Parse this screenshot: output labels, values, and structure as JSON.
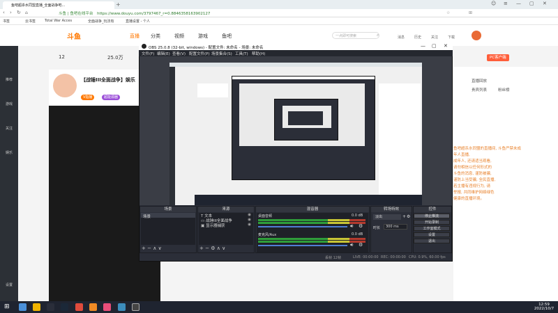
{
  "browser": {
    "tabs": [
      {
        "label": "鱼吧超杀水同盟直播_全面战争吧..."
      }
    ],
    "url": "https://www.douyu.com/3797467_r=0.8846358163902127",
    "address_prefix": "斗鱼 | 鱼吧在线平台",
    "bookmarks": [
      "书签",
      "云书签",
      "Total War Acces",
      "全面战争_玩法有",
      "直播设置 - 个人"
    ]
  },
  "site": {
    "logo": "斗鱼",
    "nav": [
      "直播",
      "分类",
      "视频",
      "游戏",
      "鱼吧"
    ],
    "search_placeholder": "一点即可搜索",
    "header_right": [
      "消息",
      "历史",
      "关注",
      "下载",
      "创作"
    ],
    "rail": [
      "推荐",
      "游戏",
      "关注",
      "娱乐",
      "设置"
    ],
    "room_title": "【战锤III全面战争】娱乐",
    "room_badge": "V指播",
    "room_tag": "超能源器",
    "chat_tabs": [
      "直播回放",
      "贵宾列表",
      "粉丝榜"
    ],
    "chat_lines": [
      "鱼吧超杀水同盟的直播间, 斗鱼严禁未成年人直播,",
      "成年人, 还请适当观看,",
      "请勿相信以任何形式的",
      "斗鱼的消息, 谨防被骗,",
      "谨防上当受骗, 全民直播,",
      "若主播有违规行为, 请",
      "举报, 共同维护网络绿色",
      "健康的直播环境。"
    ],
    "pc_tool_label": "PC客户端",
    "stats": [
      "12",
      "25.0万",
      "0",
      "0"
    ]
  },
  "obs": {
    "title": "OBS 25.0.8 (32-bit, windows) - 配置文件: 未命名 - 场景: 未命名",
    "menu": [
      "文件(F)",
      "编辑(E)",
      "查看(V)",
      "配置文件(P)",
      "场景集合(S)",
      "工具(T)",
      "帮助(H)"
    ],
    "docks": {
      "scenes": {
        "title": "场景",
        "items": [
          "场景"
        ]
      },
      "sources": {
        "title": "来源",
        "items": [
          "文本",
          "战锤III全面战争",
          "显示器捕获"
        ]
      },
      "mixer": {
        "title": "混音器",
        "channels": [
          {
            "name": "桌面音频",
            "db": "0.0 dB"
          },
          {
            "name": "麦克风/Aux",
            "db": "0.0 dB"
          }
        ]
      },
      "transitions": {
        "title": "转场特效",
        "type": "淡出",
        "duration_label": "时长",
        "duration": "300 ms"
      },
      "controls": {
        "title": "控件",
        "buttons": [
          "停止推流",
          "开始录制",
          "工作室模式",
          "设置",
          "退出"
        ]
      }
    },
    "status": {
      "dropped": "丢帧 12帧",
      "live": "LIVE: 00:00:00",
      "rec": "REC: 00:00:00",
      "cpu": "CPU: 0.9%, 60.00 fps"
    }
  },
  "taskbar": {
    "time": "12:59",
    "date": "2022/10/7"
  },
  "colors": {
    "obs_bg": "#2b2e38",
    "douyu_orange": "#ff7800",
    "meter_green": "#2f9e3a",
    "fader_blue": "#4f7fd4"
  }
}
